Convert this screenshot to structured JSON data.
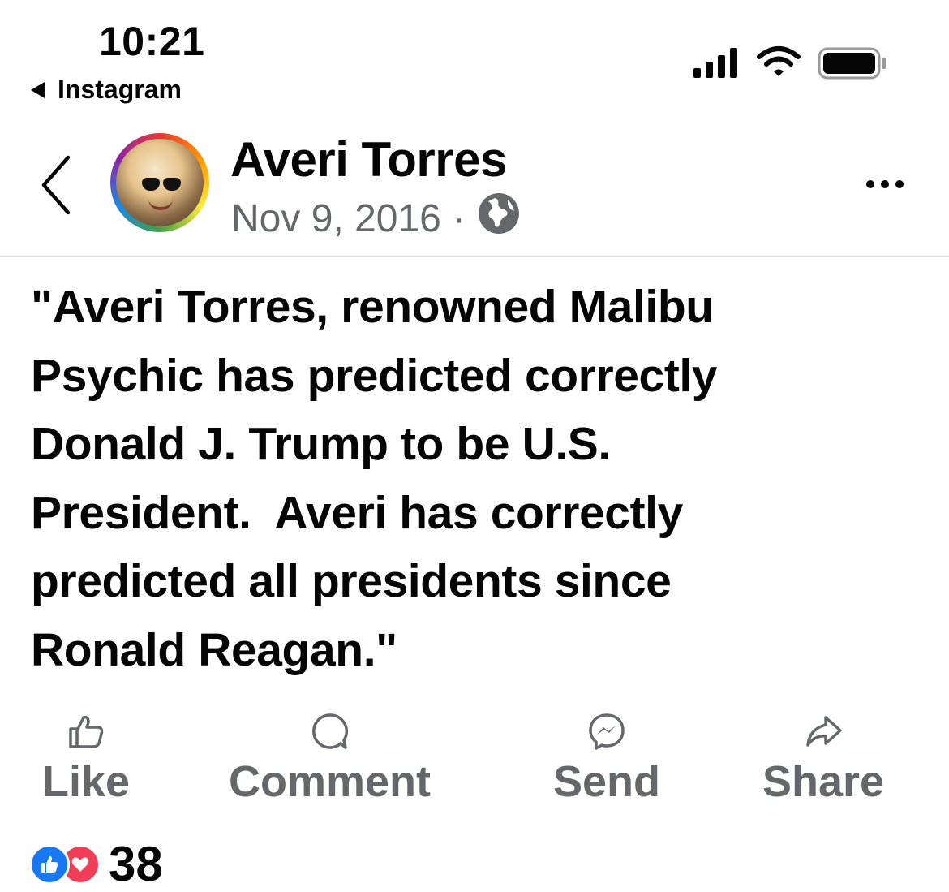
{
  "status_bar": {
    "time": "10:21",
    "back_app": "Instagram",
    "icons": [
      "signal-icon",
      "wifi-icon",
      "battery-icon"
    ]
  },
  "post": {
    "author": "Averi Torres",
    "date": "Nov 9, 2016",
    "separator": "·",
    "privacy_icon": "globe-icon",
    "text": "\"Averi Torres, renowned Malibu\nPsychic has predicted correctly\nDonald J. Trump to be U.S.\nPresident.  Averi has correctly\npredicted all presidents since\nRonald Reagan.\""
  },
  "actions": {
    "like": "Like",
    "comment": "Comment",
    "send": "Send",
    "share": "Share"
  },
  "reactions": {
    "types": [
      "like",
      "love"
    ],
    "count": "38"
  },
  "colors": {
    "text": "#050505",
    "secondary": "#65676b",
    "like_blue": "#1877f2",
    "love_red": "#f33e58"
  }
}
